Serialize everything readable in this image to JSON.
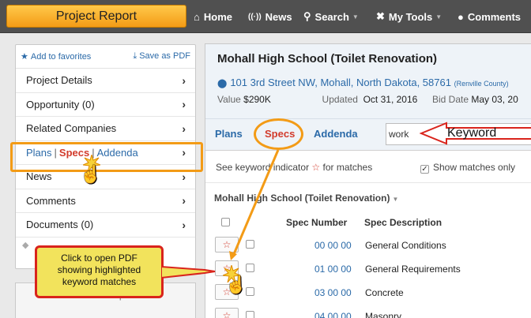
{
  "topbar": {
    "brand": "Project Report",
    "nav": [
      {
        "icon": "home-icon",
        "glyph": "⌂",
        "label": "Home",
        "caret": false
      },
      {
        "icon": "news-icon",
        "glyph": "((·))",
        "label": "News",
        "caret": false
      },
      {
        "icon": "search-icon",
        "glyph": "⚲",
        "label": "Search",
        "caret": true
      },
      {
        "icon": "tools-icon",
        "glyph": "✖",
        "label": "My Tools",
        "caret": true
      },
      {
        "icon": "comments-icon",
        "glyph": "💬",
        "label": "Comments",
        "caret": false
      }
    ]
  },
  "sidebar": {
    "add_favorites": "Add to favorites",
    "save_pdf": "Save as PDF",
    "items": [
      {
        "label": "Project Details"
      },
      {
        "label": "Opportunity",
        "count": "(0)"
      },
      {
        "label": "Related Companies"
      },
      {
        "plans": "Plans",
        "sep1": "|",
        "specs": "Specs",
        "sep2": "|",
        "addenda": "Addenda"
      },
      {
        "label": "News"
      },
      {
        "label": "Comments"
      },
      {
        "label": "Documents",
        "count": "(0)"
      }
    ],
    "related_header": "Related Companies"
  },
  "project": {
    "title": "Mohall High School (Toilet Renovation)",
    "address": "101 3rd Street NW, Mohall, North Dakota, 58761",
    "county": "(Renville County)",
    "value_label": "Value",
    "value": "$290K",
    "updated_label": "Updated",
    "updated": "Oct 31, 2016",
    "bid_label": "Bid Date",
    "bid": "May 03, 20"
  },
  "tabs": {
    "plans": "Plans",
    "specs": "Specs",
    "addenda": "Addenda",
    "search_value": "work"
  },
  "indicator": {
    "text_before": "See keyword indicator",
    "star": "☆",
    "text_after": "for matches",
    "show_matches": "Show matches only"
  },
  "section_title": "Mohall High School (Toilet Renovation)",
  "table": {
    "col_number": "Spec Number",
    "col_description": "Spec Description",
    "rows": [
      {
        "number": "00 00 00",
        "description": "General Conditions"
      },
      {
        "number": "01 00 00",
        "description": "General Requirements"
      },
      {
        "number": "03 00 00",
        "description": "Concrete"
      },
      {
        "number": "04 00 00",
        "description": "Masonry"
      }
    ]
  },
  "callouts": {
    "keyword": "Keyword",
    "pdf_line1": "Click to open PDF",
    "pdf_line2": "showing highlighted",
    "pdf_line3": "keyword matches"
  },
  "colors": {
    "accent_orange": "#f39b16",
    "callout_red": "#d9241c",
    "callout_yellow": "#f2e35c",
    "link_blue": "#2b6aa8",
    "specs_red": "#d23b2c",
    "topbar": "#505050"
  }
}
